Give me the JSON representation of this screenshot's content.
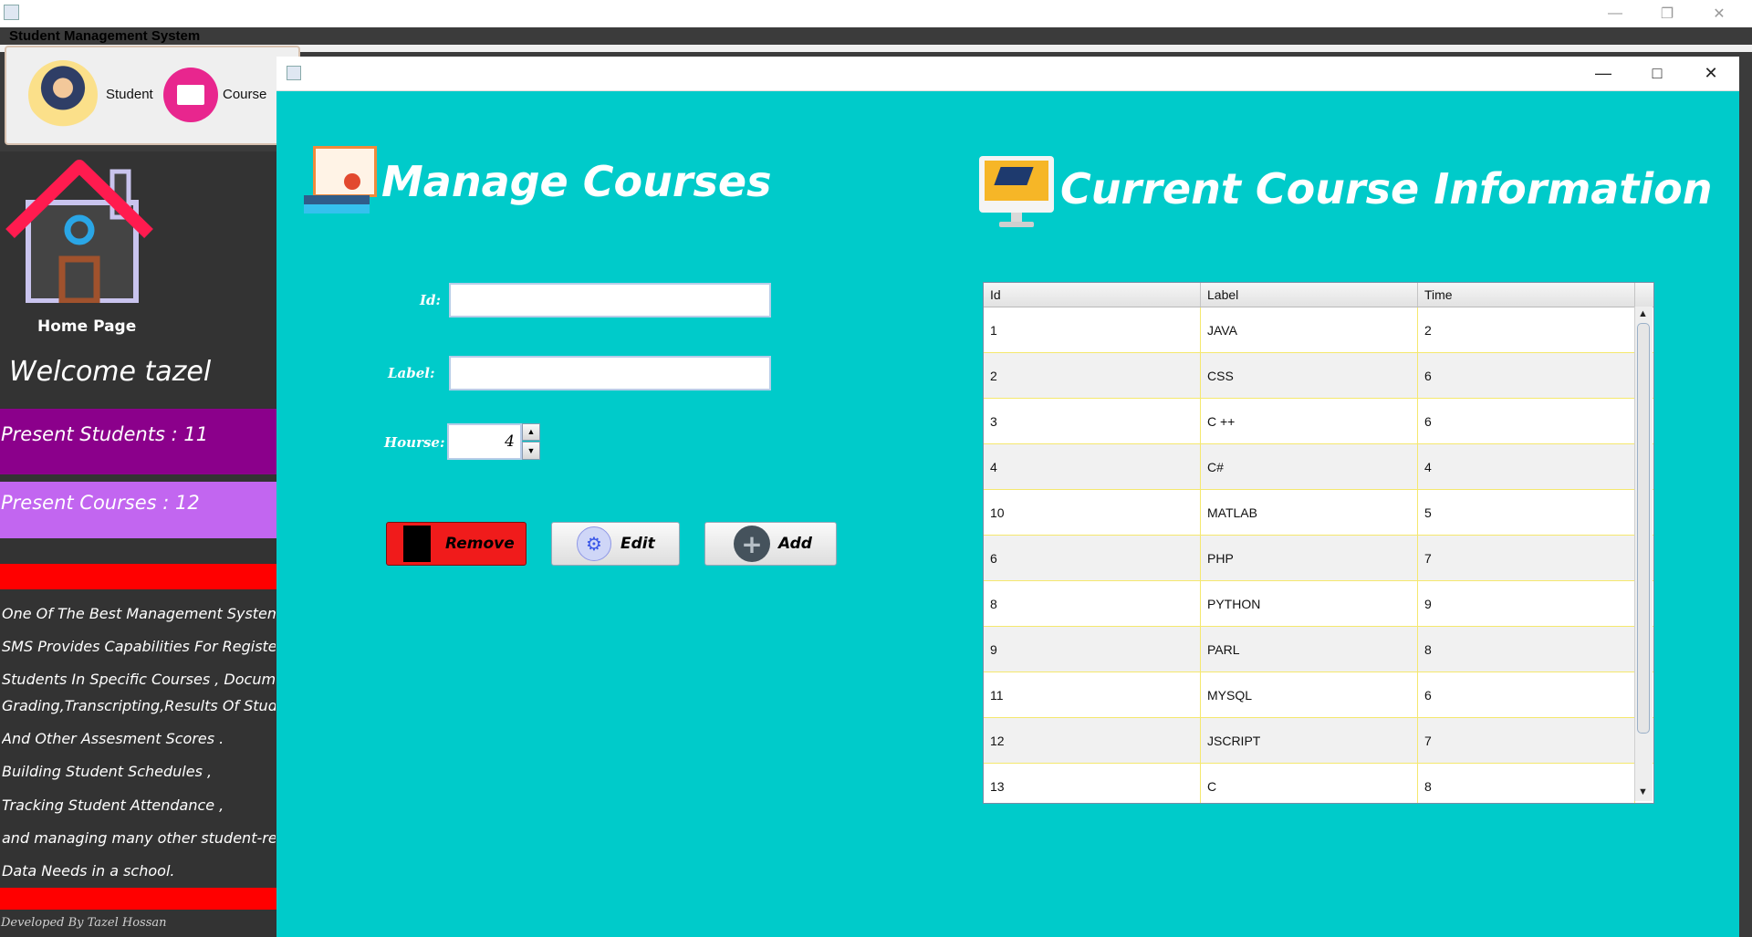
{
  "app": {
    "title": "Student Management System"
  },
  "toolbar": {
    "student_label": "Student",
    "course_label": "Course"
  },
  "sidebar": {
    "home_label": "Home Page",
    "welcome": "Welcome tazel",
    "present_students": "Present Students : 11",
    "present_courses": "Present Courses : 12",
    "about_lines": [
      "One Of The Best Management System",
      "SMS Provides Capabilities For Register",
      "Students In Specific Courses  , Docum",
      "Grading,Transcripting,Results Of Stude",
      "And Other Assesment Scores .",
      " Building Student Schedules ,",
      "Tracking Student Attendance ,",
      " and managing many other student-re",
      " Data Needs in a school."
    ],
    "footer": "Developed By Tazel Hossan"
  },
  "manage": {
    "title": "Manage Courses",
    "id_label": "Id:",
    "id_value": "",
    "label_label": "Label:",
    "label_value": "",
    "hours_label": "Hourse:",
    "hours_value": "4",
    "remove_label": "Remove",
    "edit_label": "Edit",
    "add_label": "Add"
  },
  "current": {
    "title": "Current Course Information",
    "columns": [
      "Id",
      "Label",
      "Time"
    ],
    "rows": [
      [
        "1",
        "JAVA",
        "2"
      ],
      [
        "2",
        "CSS",
        "6"
      ],
      [
        "3",
        "C ++",
        "6"
      ],
      [
        "4",
        "C#",
        "4"
      ],
      [
        "10",
        "MATLAB",
        "5"
      ],
      [
        "6",
        "PHP",
        "7"
      ],
      [
        "8",
        "PYTHON",
        "9"
      ],
      [
        "9",
        "PARL",
        "8"
      ],
      [
        "11",
        "MYSQL",
        "6"
      ],
      [
        "12",
        "JSCRIPT",
        "7"
      ],
      [
        "13",
        "C",
        "8"
      ]
    ]
  },
  "colors": {
    "accent": "#00cbca",
    "students_band": "#8b008b",
    "courses_band": "#c266f0",
    "red_band": "#ff0000",
    "remove_button": "#f01b1b"
  }
}
